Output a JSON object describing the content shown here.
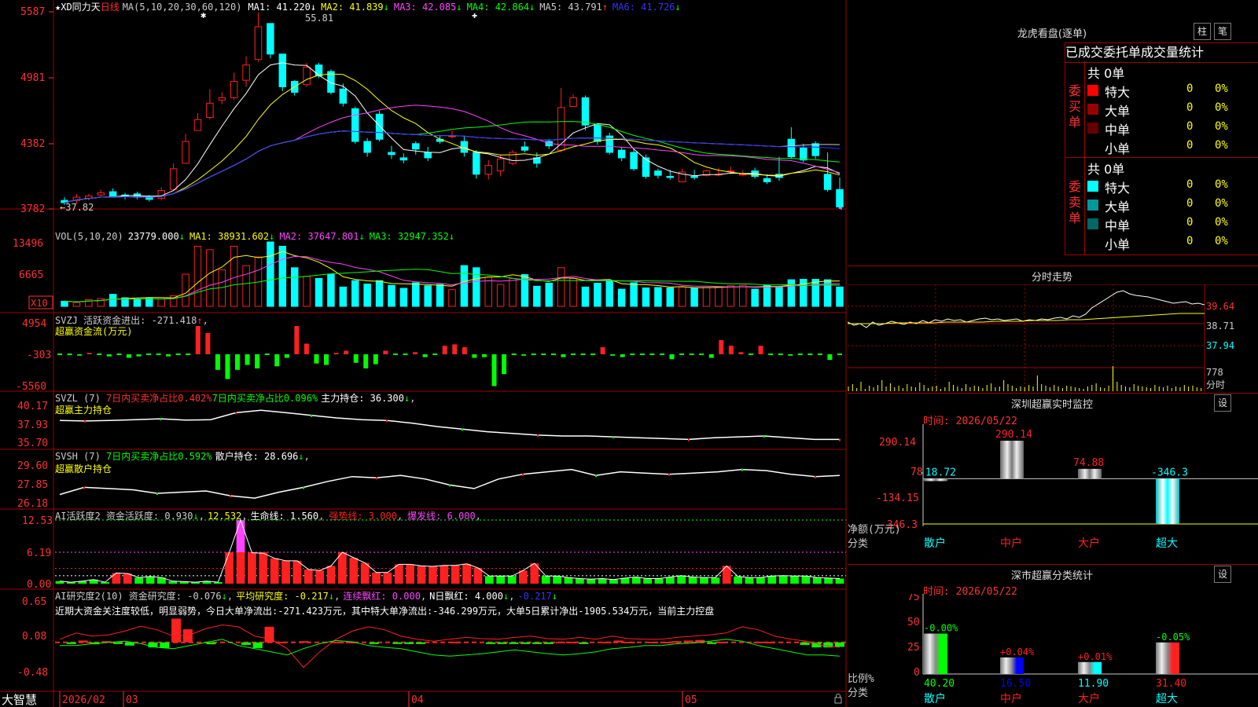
{
  "colors": {
    "up": "#ff2020",
    "down": "#00ffff",
    "grid": "#a00000",
    "ma1": "#ffffff",
    "ma2": "#ffff00",
    "ma3": "#ff44ff",
    "ma4": "#00ff00",
    "ma5": "#cccccc",
    "ma6": "#3333ff",
    "gold": "#ffff00",
    "green": "#00ff00",
    "red": "#ff2020",
    "magenta": "#ff44ff",
    "white": "#ffffff",
    "cyan": "#00ffff"
  },
  "app": {
    "brand": "大智慧",
    "lock_icon": "lock-icon"
  },
  "main_header": {
    "star": "★",
    "stock": "XD同力天",
    "period": "日线",
    "ma_params": "MA(5,10,20,30,60,120)",
    "items": [
      {
        "label": "MA1: 41.220",
        "arrow": "↓",
        "color": "#ffffff"
      },
      {
        "label": "MA2: 41.839",
        "arrow": "↓",
        "color": "#ffff00"
      },
      {
        "label": "MA3: 42.085",
        "arrow": "↓",
        "color": "#ff44ff"
      },
      {
        "label": "MA4: 42.864",
        "arrow": "↓",
        "color": "#00ff00"
      },
      {
        "label": "MA5: 43.791",
        "arrow": "↑",
        "color": "#cccccc"
      },
      {
        "label": "MA6: 41.726",
        "arrow": "↓",
        "color": "#3333ff"
      }
    ],
    "annot_high": "55.81",
    "annot_low": "37.82"
  },
  "price_axis": [
    "5587",
    "4981",
    "4382",
    "3782"
  ],
  "vol_header": {
    "title": "VOL(5,10,20)",
    "value": "23779.000",
    "arrow": "↓",
    "ma1": "MA1: 38931.602",
    "ma1_arrow": "↓",
    "ma2": "MA2: 37647.801",
    "ma2_arrow": "↓",
    "ma3": "MA3: 32947.352",
    "ma3_arrow": "↓"
  },
  "vol_axis": [
    "13496",
    "6665"
  ],
  "vol_unit": "X10",
  "svzj": {
    "title": "SVZJ  活跃资金进出: -271.418",
    "arrow": "↑",
    "suffix": ",",
    "subtitle": "超赢资金流(万元)",
    "axis": [
      "4954",
      "-303",
      "-5560"
    ]
  },
  "svzl": {
    "title": "SVZL (7) ",
    "red_part": "7日内买卖净占比0.402%",
    "green_part": "7日内买卖净占比0.096%",
    "tail": "主力持仓: 36.300",
    "arrow": "↓",
    "suffix": ",",
    "subtitle": "超赢主力持仓",
    "axis": [
      "40.17",
      "37.93",
      "35.70"
    ]
  },
  "svsh": {
    "title": "SVSH (7) ",
    "green_part": "7日内买卖净占比0.592%",
    "tail": "散户持仓: 28.696",
    "arrow": "↓",
    "suffix": ",",
    "subtitle": "超赢散户持仓",
    "axis": [
      "29.60",
      "27.85",
      "26.18"
    ]
  },
  "ai_active": {
    "title": "AI活跃度2 资金活跃度: 0.930",
    "arrow": "↓",
    "suffix": ",",
    "v2": "12.532",
    "v2_suffix": ",",
    "life": "生命线: 1.560",
    "life_suffix": ",",
    "strong": "强势线: 3.000",
    "strong_suffix": ",",
    "burst": "爆发线: 6.000",
    "burst_suffix": ",",
    "axis": [
      "12.53",
      "6.19",
      "0.00"
    ]
  },
  "ai_research": {
    "title": "AI研究度2(10) 资金研究度: -0.076",
    "arrow": "↓",
    "suffix": ",",
    "avg": "平均研究度: -0.217",
    "avg_arrow": "↓",
    "avg_suffix": ",",
    "lh": "连续飘红: 0.000",
    "lh_suffix": ",",
    "nh": "N日飘红: 4.000",
    "nh_arrow": "↓",
    "nh_suffix": ",",
    "last": "-0.217",
    "last_arrow": "↓",
    "text": "近期大资金关注度较低，明显弱势，今日大单净流出:-271.423万元，其中特大单净流出:-346.299万元，大单5日累计净出-1905.534万元，当前主力控盘",
    "axis": [
      "0.65",
      "0.08",
      "-0.48"
    ]
  },
  "time_axis": [
    "2026/02",
    "03",
    "04",
    "05"
  ],
  "dragon": {
    "title": "龙虎看盘(逐单)",
    "btn_col": "柱",
    "btn_pen": "笔",
    "header": "已成交委托单成交量统计",
    "buy": {
      "side": "委买单",
      "total": "共 0单",
      "rows": [
        {
          "name": "特大",
          "color": "#ff0000",
          "v": "0",
          "p": "0%"
        },
        {
          "name": "大单",
          "color": "#990000",
          "v": "0",
          "p": "0%"
        },
        {
          "name": "中单",
          "color": "#660000",
          "v": "0",
          "p": "0%"
        },
        {
          "name": "小单",
          "color": "#000000",
          "v": "0",
          "p": "0%"
        }
      ]
    },
    "sell": {
      "side": "委卖单",
      "total": "共 0单",
      "rows": [
        {
          "name": "特大",
          "color": "#00ffff",
          "v": "0",
          "p": "0%"
        },
        {
          "name": "大单",
          "color": "#009999",
          "v": "0",
          "p": "0%"
        },
        {
          "name": "中单",
          "color": "#006666",
          "v": "0",
          "p": "0%"
        },
        {
          "name": "小单",
          "color": "#000000",
          "v": "0",
          "p": "0%"
        }
      ]
    }
  },
  "intraday": {
    "title": "分时走势",
    "axis": [
      "39.64",
      "38.71",
      "37.94"
    ],
    "vol_label": "778",
    "vol_unit": "分时"
  },
  "sz_monitor": {
    "title": "深圳超赢实时监控",
    "btn": "设",
    "time": "时间: 2026/05/22",
    "axis": [
      "290.14",
      "78",
      "-134.15",
      "-346.3"
    ],
    "ylabel": "净额(万元)",
    "xlabel": "分类",
    "cats": [
      "散户",
      "中户",
      "大户",
      "超大"
    ],
    "values": [
      -18.72,
      290.14,
      74.88,
      -346.3
    ],
    "labels": [
      "-18.72",
      "290.14",
      "74.88",
      "-346.3"
    ]
  },
  "sz_stats": {
    "title": "深市超赢分类统计",
    "btn": "设",
    "time": "时间: 2026/05/22",
    "axis": [
      "75",
      "50",
      "25",
      "0"
    ],
    "ylabel": "比例%",
    "xlabel": "分类",
    "cats": [
      "散户",
      "中户",
      "大户",
      "超大"
    ],
    "values": [
      40.2,
      16.5,
      11.9,
      31.4
    ],
    "labels": [
      "40.20",
      "16.50",
      "11.90",
      "31.40"
    ],
    "deltas": [
      "-0.00%",
      "+0.04%",
      "+0.01%",
      "-0.05%"
    ],
    "bar_colors": [
      "#00ff00",
      "#0000ff",
      "#00ffff",
      "#ff2020"
    ],
    "delta_colors": [
      "#00ff00",
      "#ff2020",
      "#ff2020",
      "#00ff00"
    ],
    "label_colors": [
      "#00ff00",
      "#0000ff",
      "#00ffff",
      "#ff2020"
    ]
  },
  "chart_data": [
    {
      "type": "candlestick",
      "title": "XD同力天 日线",
      "ylim": [
        37.82,
        55.87
      ],
      "x": [
        "2026/02",
        "03",
        "04",
        "05"
      ],
      "open": [
        38.6,
        38.6,
        38.8,
        39.1,
        39.4,
        39.1,
        39.2,
        39.0,
        38.8,
        39.6,
        42.0,
        45.0,
        46.2,
        47.8,
        48.0,
        49.6,
        51.5,
        54.8,
        52.0,
        49.5,
        49.2,
        51.0,
        50.4,
        48.8,
        47.0,
        44.0,
        46.5,
        43.0,
        42.5,
        43.8,
        43.0,
        44.2,
        44.5,
        44.0,
        43.0,
        41.0,
        41.3,
        42.0,
        43.5,
        42.5,
        44.0,
        43.2,
        47.2,
        48.0,
        45.5,
        44.5,
        43.2,
        43.0,
        42.5,
        41.3,
        40.8,
        40.3,
        40.8,
        40.9,
        41.0,
        41.3,
        41.0,
        41.3,
        40.6,
        41.0,
        44.2,
        43.4,
        43.8,
        41.0,
        39.6
      ],
      "close": [
        38.4,
        38.9,
        39.0,
        39.3,
        39.0,
        39.0,
        38.9,
        38.7,
        39.5,
        41.5,
        44.0,
        46.0,
        47.5,
        48.0,
        49.5,
        51.0,
        54.5,
        52.0,
        49.0,
        48.5,
        50.8,
        50.0,
        48.5,
        47.5,
        44.0,
        43.0,
        44.2,
        42.8,
        42.3,
        43.3,
        42.5,
        44.0,
        44.5,
        43.0,
        41.0,
        41.8,
        42.4,
        43.0,
        43.2,
        42.0,
        43.6,
        47.1,
        48.0,
        45.5,
        44.0,
        43.0,
        42.5,
        41.5,
        40.8,
        40.9,
        40.7,
        41.2,
        40.7,
        41.3,
        41.0,
        41.3,
        41.0,
        40.8,
        40.3,
        40.7,
        42.6,
        42.3,
        42.7,
        39.6,
        38.0
      ],
      "high": [
        38.9,
        39.2,
        39.2,
        39.6,
        39.7,
        39.3,
        39.4,
        39.1,
        39.8,
        42.0,
        44.7,
        46.6,
        48.8,
        48.5,
        50.3,
        51.8,
        55.81,
        52.3,
        49.5,
        49.6,
        51.2,
        51.2,
        50.6,
        49.3,
        47.2,
        44.3,
        46.8,
        43.6,
        42.9,
        44.0,
        43.5,
        44.6,
        45.0,
        44.5,
        43.2,
        42.3,
        42.8,
        43.2,
        44.0,
        43.0,
        44.2,
        48.9,
        48.3,
        48.2,
        45.6,
        44.8,
        43.5,
        43.3,
        42.8,
        41.5,
        41.4,
        41.5,
        41.4,
        41.4,
        41.6,
        41.7,
        41.4,
        41.6,
        41.0,
        42.6,
        45.3,
        43.8,
        44.0,
        43.0,
        40.7
      ],
      "low": [
        38.2,
        38.3,
        38.6,
        38.9,
        38.9,
        38.7,
        38.7,
        38.5,
        38.6,
        39.5,
        42.0,
        45.0,
        46.0,
        47.4,
        47.8,
        49.0,
        51.3,
        51.6,
        48.6,
        48.2,
        49.0,
        49.8,
        48.3,
        47.2,
        43.8,
        42.6,
        44.0,
        42.4,
        42.0,
        42.8,
        42.2,
        43.8,
        44.3,
        42.6,
        40.6,
        40.5,
        40.8,
        41.8,
        43.0,
        41.6,
        43.3,
        43.0,
        47.6,
        45.0,
        43.7,
        42.8,
        42.2,
        41.3,
        40.6,
        40.6,
        40.5,
        40.9,
        40.5,
        40.8,
        40.8,
        41.0,
        40.8,
        40.6,
        40.1,
        40.4,
        42.4,
        42.1,
        42.4,
        39.4,
        37.82
      ]
    },
    {
      "type": "bar",
      "title": "VOL(5,10,20)",
      "values": [
        1200,
        900,
        1600,
        1800,
        2800,
        2000,
        1700,
        2000,
        1700,
        2500,
        7500,
        14000,
        13200,
        8500,
        14000,
        9500,
        11500,
        15000,
        14000,
        9000,
        7000,
        6500,
        7500,
        4500,
        6000,
        5200,
        6000,
        4900,
        4200,
        5500,
        4800,
        5100,
        3900,
        9500,
        9000,
        6800,
        5100,
        6500,
        7400,
        4700,
        5400,
        9000,
        6500,
        4500,
        5400,
        6000,
        4000,
        5500,
        4300,
        4400,
        4300,
        4500,
        4300,
        4400,
        4500,
        4800,
        4900,
        4000,
        4900,
        4600,
        6200,
        6300,
        6300,
        6200,
        4500,
        3500
      ]
    },
    {
      "type": "bar",
      "title": "超赢资金流(万元)",
      "values": [
        0,
        0,
        -200,
        200,
        0,
        -300,
        0,
        -500,
        -300,
        0,
        0,
        -300,
        0,
        0,
        4000,
        3000,
        -2200,
        -3500,
        -2200,
        -1500,
        -2000,
        0,
        -1700,
        -500,
        4000,
        1500,
        -1300,
        -1500,
        200,
        500,
        -1200,
        -2000,
        -1400,
        500,
        0,
        0,
        300,
        -400,
        0,
        1200,
        1400,
        1000,
        -500,
        -400,
        -4500,
        -2800,
        0,
        -200,
        0,
        0,
        0,
        -400,
        0,
        0,
        0,
        1000,
        -200,
        -400,
        0,
        0,
        0,
        0,
        -700,
        0,
        0,
        0,
        -500,
        2000,
        1200,
        300,
        0,
        1200,
        0,
        0,
        -200,
        0,
        0,
        0,
        -800,
        0
      ]
    },
    {
      "type": "line",
      "title": "超赢主力持仓",
      "ylim": [
        35.7,
        40.17
      ],
      "values": [
        38.5,
        38.45,
        38.5,
        38.6,
        38.7,
        38.55,
        38.6,
        39.4,
        39.7,
        39.4,
        39.1,
        38.8,
        38.6,
        38.5,
        38.2,
        37.8,
        37.5,
        37.2,
        37.0,
        36.8,
        36.7,
        36.7,
        36.6,
        36.5,
        36.4,
        36.3,
        36.5,
        36.6,
        36.7,
        36.5,
        36.3,
        36.3
      ]
    },
    {
      "type": "line",
      "title": "超赢散户持仓",
      "ylim": [
        26.18,
        29.6
      ],
      "values": [
        27.0,
        27.6,
        27.5,
        27.4,
        27.1,
        27.2,
        27.3,
        26.9,
        26.7,
        27.2,
        27.6,
        28.1,
        28.5,
        28.4,
        28.6,
        28.3,
        27.8,
        27.5,
        28.3,
        28.7,
        28.9,
        29.1,
        28.6,
        28.9,
        28.8,
        28.7,
        28.8,
        28.9,
        29.1,
        29.0,
        28.7,
        28.5,
        28.6
      ]
    },
    {
      "type": "bar",
      "title": "AI活跃度2",
      "ylim": [
        0,
        12.53
      ],
      "values": [
        0.5,
        0.3,
        0.5,
        0.8,
        0.3,
        2.1,
        2.0,
        1.2,
        1.4,
        1.2,
        0.5,
        0.4,
        0.3,
        0.5,
        0.3,
        6.19,
        12.5,
        6.1,
        6.0,
        5.0,
        4.5,
        4.5,
        2.8,
        2.6,
        3.5,
        6.19,
        5.1,
        4.1,
        2.2,
        2.2,
        3.8,
        3.8,
        3.5,
        3.4,
        3.6,
        3.6,
        3.9,
        3.1,
        1.5,
        1.5,
        1.5,
        2.6,
        4.0,
        1.5,
        1.5,
        1.2,
        1.0,
        0.9,
        1.0,
        0.8,
        1.1,
        1.3,
        1.0,
        1.0,
        1.3,
        1.6,
        1.3,
        1.2,
        1.2,
        3.5,
        1.4,
        1.2,
        1.2,
        1.5,
        1.6,
        1.5,
        1.5,
        1.2,
        1.1,
        1.0
      ]
    },
    {
      "type": "bar",
      "title": "AI研究度2(10)",
      "ylim": [
        -0.48,
        0.65
      ],
      "values": [
        0,
        -0.02,
        0.03,
        -0.03,
        0.02,
        -0.02,
        -0.05,
        0,
        -0.08,
        -0.09,
        0.38,
        0.21,
        0,
        -0.03,
        0,
        0,
        -0.04,
        -0.09,
        0.25,
        0.01,
        0,
        0.02,
        0,
        0,
        0.01,
        0.01,
        0,
        -0.02,
        0,
        -0.02,
        -0.02,
        -0.01,
        0,
        0,
        0.01,
        0,
        0,
        -0.02,
        -0.01,
        -0.01,
        -0.01,
        -0.01,
        -0.01,
        0.01,
        0.01,
        -0.01,
        0,
        0.01,
        0.03,
        0.01,
        0,
        0.01,
        0.01,
        0.02,
        0.03,
        0.04,
        -0.02,
        0.01,
        0,
        0,
        0.01,
        0.01,
        0,
        0,
        -0.04,
        -0.08,
        -0.08,
        -0.07
      ]
    },
    {
      "type": "bar",
      "title": "深圳超赢实时监控",
      "categories": [
        "散户",
        "中户",
        "大户",
        "超大"
      ],
      "values": [
        -18.72,
        290.14,
        74.88,
        -346.3
      ],
      "ylabel": "净额(万元)",
      "xlabel": "分类",
      "ylim": [
        -346.3,
        290.14
      ]
    },
    {
      "type": "bar",
      "title": "深市超赢分类统计",
      "categories": [
        "散户",
        "中户",
        "大户",
        "超大"
      ],
      "values": [
        40.2,
        16.5,
        11.9,
        31.4
      ],
      "ylabel": "比例%",
      "xlabel": "分类",
      "ylim": [
        0,
        75
      ]
    }
  ]
}
